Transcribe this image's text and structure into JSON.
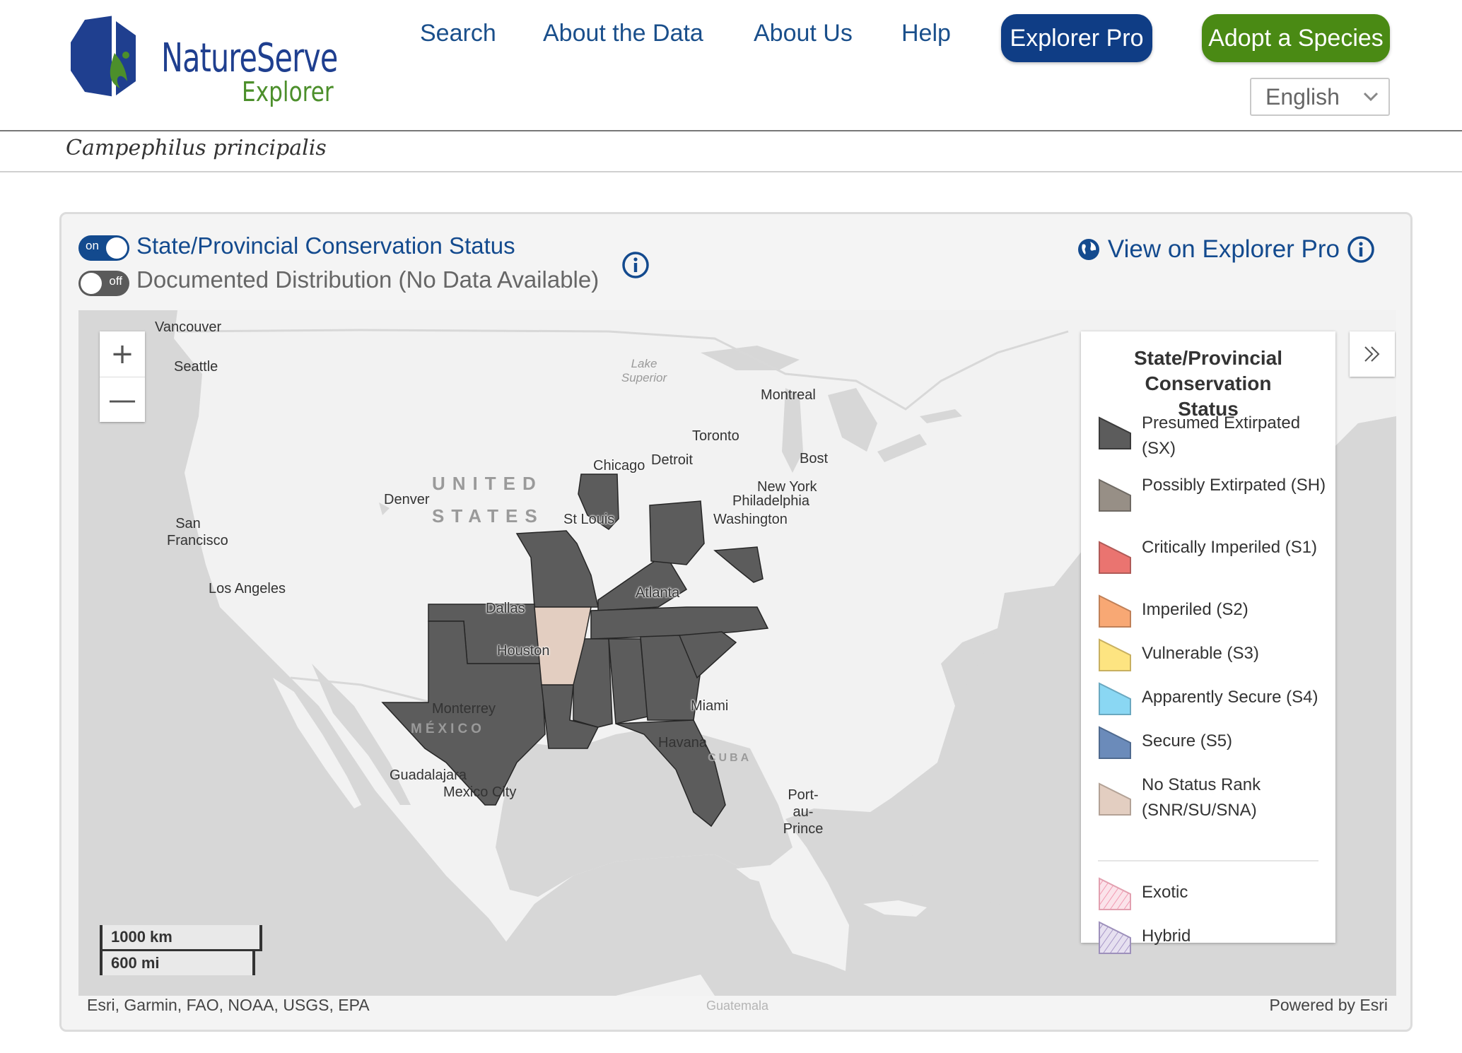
{
  "header": {
    "logo": {
      "line1": "NatureServe",
      "line2": "Explorer"
    },
    "nav": [
      {
        "label": "Search"
      },
      {
        "label": "About the Data"
      },
      {
        "label": "About Us"
      },
      {
        "label": "Help"
      }
    ],
    "explorer_pro_label": "Explorer Pro",
    "adopt_label": "Adopt a Species",
    "language": "English"
  },
  "species_name": "Campephilus principalis",
  "map_panel": {
    "layers": [
      {
        "toggle": "on",
        "label": "State/Provincial Conservation Status"
      },
      {
        "toggle": "off",
        "label": "Documented Distribution (No Data Available)"
      }
    ],
    "view_pro_label": "View on Explorer Pro",
    "zoom_in": "+",
    "zoom_out": "—",
    "scale": {
      "km": "1000 km",
      "mi": "600 mi"
    },
    "attribution_left": "Esri, Garmin, FAO, NOAA, USGS, EPA",
    "attribution_right": "Powered by Esri",
    "attribution_center": "Guatemala",
    "cities": {
      "vancouver": "Vancouver",
      "seattle": "Seattle",
      "montreal": "Montreal",
      "toronto": "Toronto",
      "detroit": "Detroit",
      "boston": "Bost",
      "new_york": "New York",
      "philadelphia": "Philadelphia",
      "washington": "Washington",
      "chicago": "Chicago",
      "st_louis": "St Louis",
      "denver": "Denver",
      "san_francisco": "San Francisco",
      "los_angeles": "Los Angeles",
      "dallas": "Dallas",
      "houston": "Houston",
      "atlanta": "Atlanta",
      "miami": "Miami",
      "monterrey": "Monterrey",
      "havana": "Havana",
      "guadalajara": "Guadalajara",
      "mexico_city": "Mexico City",
      "port_au_prince": "Port-au-Prince"
    },
    "labels": {
      "united": "UNITED",
      "states": "STATES",
      "mexico": "MÉXICO",
      "cuba": "CUBA",
      "lake_superior": "Lake Superior"
    }
  },
  "legend": {
    "title": "State/Provincial Conservation Status",
    "items": [
      {
        "label": "Presumed Extirpated (SX)",
        "color": "#5c5c5c"
      },
      {
        "label": "Possibly Extirpated (SH)",
        "color": "#978f86"
      },
      {
        "label": "Critically Imperiled (S1)",
        "color": "#ea7470"
      },
      {
        "label": "Imperiled (S2)",
        "color": "#f8a874"
      },
      {
        "label": "Vulnerable (S3)",
        "color": "#fde481"
      },
      {
        "label": "Apparently Secure (S4)",
        "color": "#8ad7f3"
      },
      {
        "label": "Secure (S5)",
        "color": "#6b8bba"
      },
      {
        "label": "No Status Rank (SNR/SU/SNA)",
        "color": "#e3cec1"
      }
    ],
    "extra_items": [
      {
        "label": "Exotic",
        "color": "#f7c8d3"
      },
      {
        "label": "Hybrid",
        "color": "#c9bfdc"
      }
    ]
  },
  "colors": {
    "brand_blue": "#134a8e",
    "nav_text": "#1a4f8b",
    "brand_green": "#4a8a14",
    "land": "#f2f2f2",
    "water": "#d7d7d7",
    "status_sx": "#5c5c5c",
    "status_snr": "#e3cec1"
  }
}
